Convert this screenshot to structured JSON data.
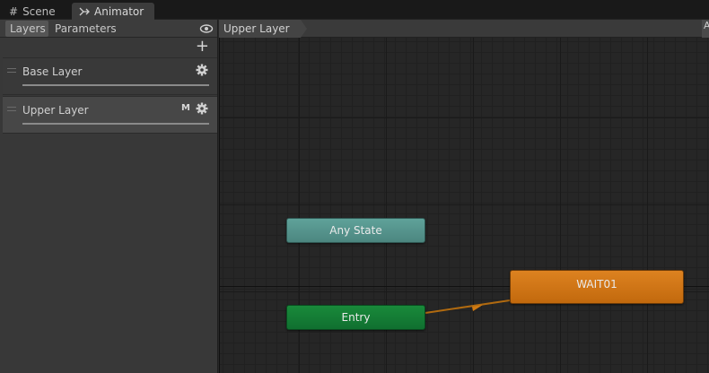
{
  "window_tabs": [
    {
      "label": "Scene",
      "icon": "grid-icon"
    },
    {
      "label": "Animator",
      "icon": "animator-icon"
    }
  ],
  "left_panel": {
    "tabs": [
      {
        "label": "Layers",
        "active": true
      },
      {
        "label": "Parameters",
        "active": false
      }
    ],
    "layers": [
      {
        "name": "Base Layer",
        "badge": ""
      },
      {
        "name": "Upper Layer",
        "badge": "M",
        "selected": true
      }
    ]
  },
  "graph": {
    "breadcrumb": "Upper Layer",
    "corner_button": "A",
    "nodes": {
      "any_state": "Any State",
      "entry": "Entry",
      "state": "WAIT01"
    }
  },
  "colors": {
    "any_state": "#5fa29a",
    "entry": "#198a3a",
    "state": "#dd8220",
    "transition": "#b06a10"
  }
}
